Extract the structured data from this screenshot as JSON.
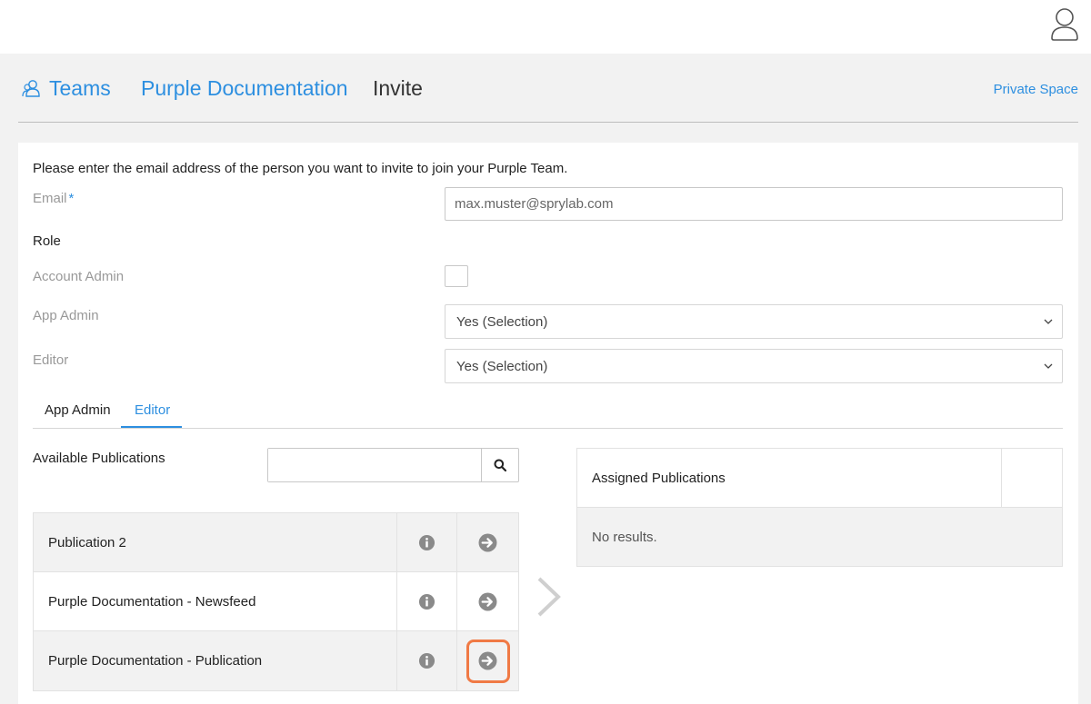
{
  "breadcrumb": {
    "teams": "Teams",
    "team_name": "Purple Documentation",
    "current": "Invite"
  },
  "header": {
    "private_space": "Private Space"
  },
  "form": {
    "intro": "Please enter the email address of the person you want to invite to join your Purple Team.",
    "email_label": "Email",
    "email_required": "*",
    "email_value": "max.muster@sprylab.com",
    "role_heading": "Role",
    "account_admin_label": "Account Admin",
    "account_admin_checked": false,
    "app_admin_label": "App Admin",
    "app_admin_value": "Yes (Selection)",
    "editor_label": "Editor",
    "editor_value": "Yes (Selection)"
  },
  "tabs": [
    {
      "label": "App Admin",
      "active": false
    },
    {
      "label": "Editor",
      "active": true
    }
  ],
  "available": {
    "title": "Available Publications",
    "search_value": "",
    "rows": [
      {
        "name": "Publication 2"
      },
      {
        "name": "Purple Documentation - Newsfeed"
      },
      {
        "name": "Purple Documentation - Publication",
        "highlighted": true
      }
    ]
  },
  "assigned": {
    "title": "Assigned Publications",
    "empty_text": "No results."
  },
  "colors": {
    "accent": "#2d8fe0",
    "highlight": "#f07a45",
    "icon_gray": "#8a8a8a"
  }
}
